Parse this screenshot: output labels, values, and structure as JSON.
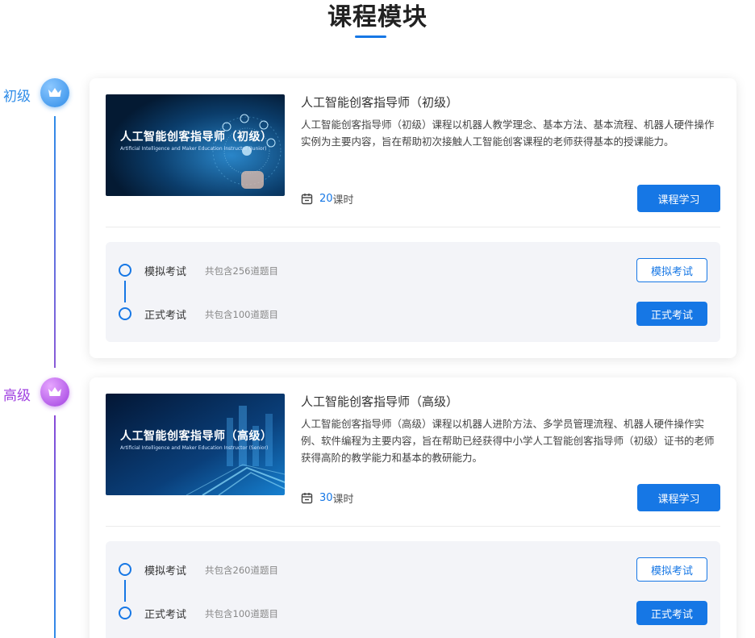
{
  "page": {
    "title": "课程模块"
  },
  "colors": {
    "accent": "#1677e5",
    "level1": "#2f8ce8",
    "level2": "#a040e0"
  },
  "levels": [
    {
      "label": "初级",
      "badge_icon": "crown-icon",
      "course": {
        "thumb_title": "人工智能创客指导师（初级）",
        "thumb_sub": "Artificial Intelligence and Maker Education Instructor (Junior)",
        "name": "人工智能创客指导师（初级）",
        "desc": "人工智能创客指导师（初级）课程以机器人教学理念、基本方法、基本流程、机器人硬件操作实例为主要内容，旨在帮助初次接触人工智能创客课程的老师获得基本的授课能力。",
        "hours_num": "20",
        "hours_unit": "课时",
        "study_btn": "课程学习"
      },
      "exams": [
        {
          "name": "模拟考试",
          "count": "共包含256道题目",
          "btn": "模拟考试"
        },
        {
          "name": "正式考试",
          "count": "共包含100道题目",
          "btn": "正式考试"
        }
      ]
    },
    {
      "label": "高级",
      "badge_icon": "crown-icon",
      "course": {
        "thumb_title": "人工智能创客指导师（高级）",
        "thumb_sub": "Artificial Intelligence and Maker Education Instructor (Senior)",
        "name": "人工智能创客指导师（高级）",
        "desc": "人工智能创客指导师（高级）课程以机器人进阶方法、多学员管理流程、机器人硬件操作实例、软件编程为主要内容，旨在帮助已经获得中小学人工智能创客指导师（初级）证书的老师获得高阶的教学能力和基本的教研能力。",
        "hours_num": "30",
        "hours_unit": "课时",
        "study_btn": "课程学习"
      },
      "exams": [
        {
          "name": "模拟考试",
          "count": "共包含260道题目",
          "btn": "模拟考试"
        },
        {
          "name": "正式考试",
          "count": "共包含100道题目",
          "btn": "正式考试"
        }
      ]
    }
  ]
}
